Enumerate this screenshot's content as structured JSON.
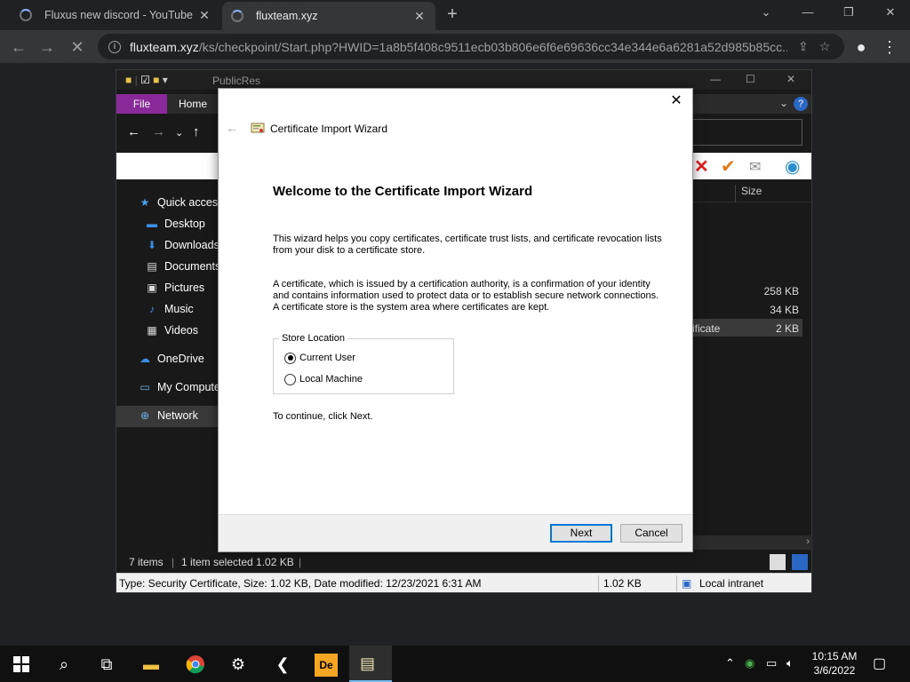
{
  "browser": {
    "tabs": [
      {
        "title": "Fluxus new discord - YouTube"
      },
      {
        "title": "fluxteam.xyz"
      }
    ],
    "url_host": "fluxteam.xyz",
    "url_path": "/ks/checkpoint/Start.php?HWID=1a8b5f408c9511ecb03b806e6f6e69636cc34e344e6a6281a52d985b85cc..."
  },
  "explorer": {
    "title": "PublicRes",
    "ribbon": {
      "file": "File",
      "home": "Home"
    },
    "sidebar": [
      {
        "label": "Quick access",
        "icon": "star-icon"
      },
      {
        "label": "Desktop",
        "icon": "desktop-icon"
      },
      {
        "label": "Downloads",
        "icon": "downloads-icon"
      },
      {
        "label": "Documents",
        "icon": "documents-icon"
      },
      {
        "label": "Pictures",
        "icon": "pictures-icon"
      },
      {
        "label": "Music",
        "icon": "music-icon"
      },
      {
        "label": "Videos",
        "icon": "videos-icon"
      },
      {
        "label": "OneDrive",
        "icon": "onedrive-icon"
      },
      {
        "label": "My Compute",
        "icon": "computer-icon"
      },
      {
        "label": "Network",
        "icon": "network-icon"
      }
    ],
    "size_header": "Size",
    "rows": [
      {
        "name": "",
        "size": "258 KB"
      },
      {
        "name": "",
        "size": "34 KB"
      },
      {
        "name": "ificate",
        "size": "2 KB"
      }
    ],
    "status": {
      "items": "7 items",
      "selected": "1 item selected  1.02 KB"
    },
    "info": {
      "details": "Type: Security Certificate, Size: 1.02 KB, Date modified: 12/23/2021 6:31 AM",
      "size": "1.02 KB",
      "zone": "Local intranet"
    }
  },
  "wizard": {
    "header": "Certificate Import Wizard",
    "title": "Welcome to the Certificate Import Wizard",
    "para1": "This wizard helps you copy certificates, certificate trust lists, and certificate revocation lists from your disk to a certificate store.",
    "para2": "A certificate, which is issued by a certification authority, is a confirmation of your identity and contains information used to protect data or to establish secure network connections. A certificate store is the system area where certificates are kept.",
    "store_location": "Store Location",
    "options": [
      {
        "label": "Current User",
        "checked": true
      },
      {
        "label": "Local Machine",
        "checked": false
      }
    ],
    "continue": "To continue, click Next.",
    "next": "Next",
    "cancel": "Cancel"
  },
  "taskbar": {
    "time": "10:15 AM",
    "date": "3/6/2022"
  },
  "colors": {
    "accent": "#0078d7",
    "file_tab": "#8a2a9a"
  }
}
